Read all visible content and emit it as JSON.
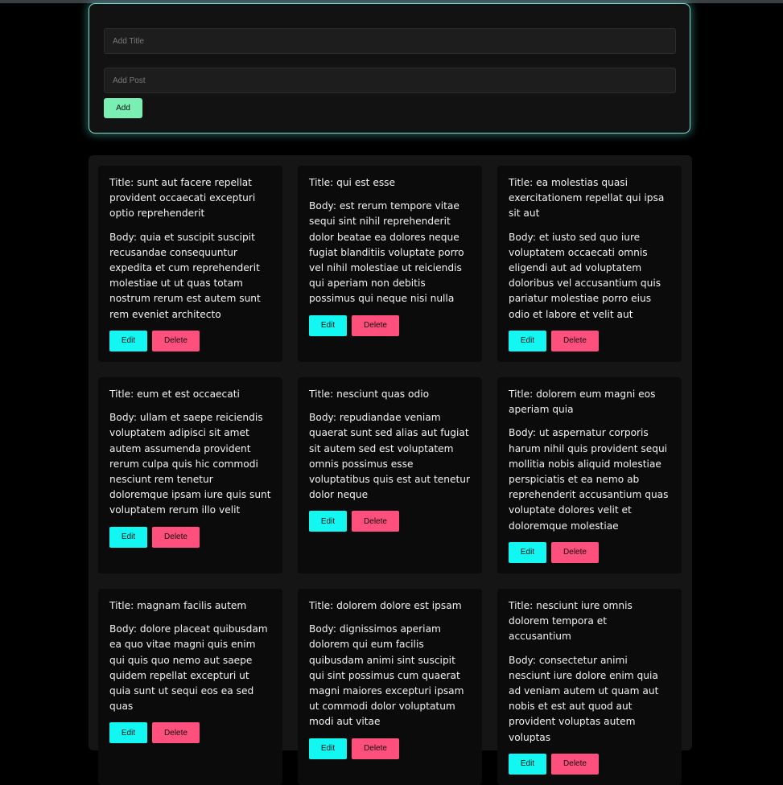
{
  "form": {
    "title_placeholder": "Add Title",
    "post_placeholder": "Add Post",
    "add_label": "Add"
  },
  "posts": [
    {
      "title": "Title: sunt aut facere repellat provident occaecati excepturi optio reprehenderit",
      "body": "Body: quia et suscipit suscipit recusandae consequuntur expedita et cum reprehenderit molestiae ut ut quas totam nostrum rerum est autem sunt rem eveniet architecto",
      "edit_label": "Edit",
      "delete_label": "Delete"
    },
    {
      "title": "Title: qui est esse",
      "body": "Body: est rerum tempore vitae sequi sint nihil reprehenderit dolor beatae ea dolores neque fugiat blanditiis voluptate porro vel nihil molestiae ut reiciendis qui aperiam non debitis possimus qui neque nisi nulla",
      "edit_label": "Edit",
      "delete_label": "Delete"
    },
    {
      "title": "Title: ea molestias quasi exercitationem repellat qui ipsa sit aut",
      "body": "Body: et iusto sed quo iure voluptatem occaecati omnis eligendi aut ad voluptatem doloribus vel accusantium quis pariatur molestiae porro eius odio et labore et velit aut",
      "edit_label": "Edit",
      "delete_label": "Delete"
    },
    {
      "title": "Title: eum et est occaecati",
      "body": "Body: ullam et saepe reiciendis voluptatem adipisci sit amet autem assumenda provident rerum culpa quis hic commodi nesciunt rem tenetur doloremque ipsam iure quis sunt voluptatem rerum illo velit",
      "edit_label": "Edit",
      "delete_label": "Delete"
    },
    {
      "title": "Title: nesciunt quas odio",
      "body": "Body: repudiandae veniam quaerat sunt sed alias aut fugiat sit autem sed est voluptatem omnis possimus esse voluptatibus quis est aut tenetur dolor neque",
      "edit_label": "Edit",
      "delete_label": "Delete"
    },
    {
      "title": "Title: dolorem eum magni eos aperiam quia",
      "body": "Body: ut aspernatur corporis harum nihil quis provident sequi mollitia nobis aliquid molestiae perspiciatis et ea nemo ab reprehenderit accusantium quas voluptate dolores velit et doloremque molestiae",
      "edit_label": "Edit",
      "delete_label": "Delete"
    },
    {
      "title": "Title: magnam facilis autem",
      "body": "Body: dolore placeat quibusdam ea quo vitae magni quis enim qui quis quo nemo aut saepe quidem repellat excepturi ut quia sunt ut sequi eos ea sed quas",
      "edit_label": "Edit",
      "delete_label": "Delete"
    },
    {
      "title": "Title: dolorem dolore est ipsam",
      "body": "Body: dignissimos aperiam dolorem qui eum facilis quibusdam animi sint suscipit qui sint possimus cum quaerat magni maiores excepturi ipsam ut commodi dolor voluptatum modi aut vitae",
      "edit_label": "Edit",
      "delete_label": "Delete"
    },
    {
      "title": "Title: nesciunt iure omnis dolorem tempora et accusantium",
      "body": "Body: consectetur animi nesciunt iure dolore enim quia ad veniam autem ut quam aut nobis et est aut quod aut provident voluptas autem voluptas",
      "edit_label": "Edit",
      "delete_label": "Delete"
    }
  ]
}
